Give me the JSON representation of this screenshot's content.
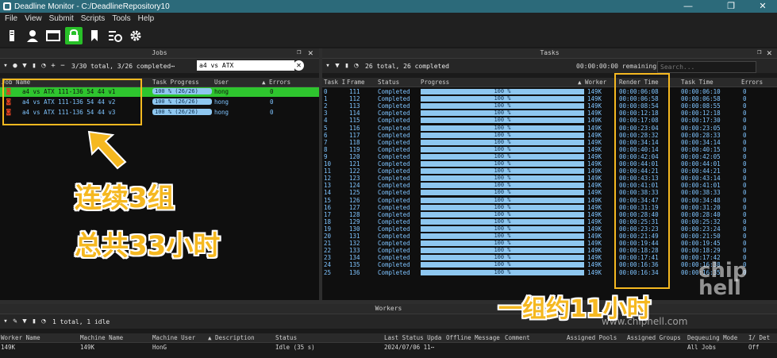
{
  "window": {
    "title": "Deadline Monitor - C:/DeadlineRepository10",
    "controls": [
      "—",
      "❐",
      "✕"
    ]
  },
  "menu": [
    "File",
    "View",
    "Submit",
    "Scripts",
    "Tools",
    "Help"
  ],
  "toolbar": {
    "icons": [
      "device-icon",
      "user-icon",
      "monitor-icon",
      "lock-icon",
      "bookmark-icon",
      "settings-list-icon",
      "gear-icon"
    ]
  },
  "jobs": {
    "title": "Jobs",
    "summary": "3/30 total, 3/26 completed⋯",
    "search_value": "a4 vs ATX",
    "columns": [
      "Job Name",
      "Task Progress",
      "User",
      "▲ Errors"
    ],
    "rows": [
      {
        "name": "a4 vs ATX 111-136 54 44 v1",
        "progress": "100 %   (26/26)",
        "user": "hong",
        "errors": "0",
        "selected": true
      },
      {
        "name": "a4 vs ATX 111-136 54 44 v2",
        "progress": "100 %   (26/26)",
        "user": "hong",
        "errors": "0",
        "selected": false
      },
      {
        "name": "a4 vs ATX 111-136 54 44 v3",
        "progress": "100 %   (26/26)",
        "user": "hong",
        "errors": "0",
        "selected": false
      }
    ]
  },
  "tasks": {
    "title": "Tasks",
    "summary": "26 total, 26 completed",
    "remaining": "00:00:00:00 remaining",
    "search_placeholder": "Search...",
    "columns": [
      "Task I",
      "Frame",
      "Status",
      "Progress",
      "▲ Worker",
      "Render Time",
      "Task Time",
      "Errors"
    ],
    "rows": [
      [
        "0",
        "111",
        "Completed",
        "100 %",
        "149K",
        "00:00:06:08",
        "00:00:06:10",
        "0"
      ],
      [
        "1",
        "112",
        "Completed",
        "100 %",
        "149K",
        "00:00:06:58",
        "00:00:06:58",
        "0"
      ],
      [
        "2",
        "113",
        "Completed",
        "100 %",
        "149K",
        "00:00:08:54",
        "00:00:08:55",
        "0"
      ],
      [
        "3",
        "114",
        "Completed",
        "100 %",
        "149K",
        "00:00:12:18",
        "00:00:12:18",
        "0"
      ],
      [
        "4",
        "115",
        "Completed",
        "100 %",
        "149K",
        "00:00:17:08",
        "00:00:17:30",
        "0"
      ],
      [
        "5",
        "116",
        "Completed",
        "100 %",
        "149K",
        "00:00:23:04",
        "00:00:23:05",
        "0"
      ],
      [
        "6",
        "117",
        "Completed",
        "100 %",
        "149K",
        "00:00:28:32",
        "00:00:28:33",
        "0"
      ],
      [
        "7",
        "118",
        "Completed",
        "100 %",
        "149K",
        "00:00:34:14",
        "00:00:34:14",
        "0"
      ],
      [
        "8",
        "119",
        "Completed",
        "100 %",
        "149K",
        "00:00:40:14",
        "00:00:40:15",
        "0"
      ],
      [
        "9",
        "120",
        "Completed",
        "100 %",
        "149K",
        "00:00:42:04",
        "00:00:42:05",
        "0"
      ],
      [
        "10",
        "121",
        "Completed",
        "100 %",
        "149K",
        "00:00:44:01",
        "00:00:44:01",
        "0"
      ],
      [
        "11",
        "122",
        "Completed",
        "100 %",
        "149K",
        "00:00:44:21",
        "00:00:44:21",
        "0"
      ],
      [
        "12",
        "123",
        "Completed",
        "100 %",
        "149K",
        "00:00:43:13",
        "00:00:43:14",
        "0"
      ],
      [
        "13",
        "124",
        "Completed",
        "100 %",
        "149K",
        "00:00:41:01",
        "00:00:41:01",
        "0"
      ],
      [
        "14",
        "125",
        "Completed",
        "100 %",
        "149K",
        "00:00:38:33",
        "00:00:38:33",
        "0"
      ],
      [
        "15",
        "126",
        "Completed",
        "100 %",
        "149K",
        "00:00:34:47",
        "00:00:34:48",
        "0"
      ],
      [
        "16",
        "127",
        "Completed",
        "100 %",
        "149K",
        "00:00:31:19",
        "00:00:31:20",
        "0"
      ],
      [
        "17",
        "128",
        "Completed",
        "100 %",
        "149K",
        "00:00:28:40",
        "00:00:28:40",
        "0"
      ],
      [
        "18",
        "129",
        "Completed",
        "100 %",
        "149K",
        "00:00:25:31",
        "00:00:25:32",
        "0"
      ],
      [
        "19",
        "130",
        "Completed",
        "100 %",
        "149K",
        "00:00:23:23",
        "00:00:23:24",
        "0"
      ],
      [
        "20",
        "131",
        "Completed",
        "100 %",
        "149K",
        "00:00:21:49",
        "00:00:21:50",
        "0"
      ],
      [
        "21",
        "132",
        "Completed",
        "100 %",
        "149K",
        "00:00:19:44",
        "00:00:19:45",
        "0"
      ],
      [
        "22",
        "133",
        "Completed",
        "100 %",
        "149K",
        "00:00:18:28",
        "00:00:18:29",
        "0"
      ],
      [
        "23",
        "134",
        "Completed",
        "100 %",
        "149K",
        "00:00:17:41",
        "00:00:17:42",
        "0"
      ],
      [
        "24",
        "135",
        "Completed",
        "100 %",
        "149K",
        "00:00:16:36",
        "00:00:16:38",
        "0"
      ],
      [
        "25",
        "136",
        "Completed",
        "100 %",
        "149K",
        "00:00:16:34",
        "00:00:16:35",
        "0"
      ]
    ]
  },
  "workers": {
    "title": "Workers",
    "summary": "1 total, 1 idle",
    "columns": [
      "Worker Name",
      "Machine Name",
      "Machine User",
      "▲ Description",
      "Status",
      "Last Status Upda",
      "Offline Message",
      "Comment",
      "Assigned Pools",
      "Assigned Groups",
      "Dequeuing Mode",
      "I/ Det"
    ],
    "row": [
      "149K",
      "149K",
      "HonG",
      "",
      "Idle (35 s)",
      "2024/07/06 11⋯",
      "",
      "",
      "",
      "",
      "All Jobs",
      "Off"
    ]
  },
  "annotations": {
    "line1": "连续3组",
    "line2": "总共33小时",
    "bottom": "一组约11小时"
  },
  "watermark": {
    "logo": "chip hell",
    "url": "www.chiphell.com"
  },
  "colors": {
    "accent": "#f5b820",
    "selected_row": "#2ec52e",
    "progress": "#8ec7f0",
    "titlebar": "#2c6a7a"
  }
}
